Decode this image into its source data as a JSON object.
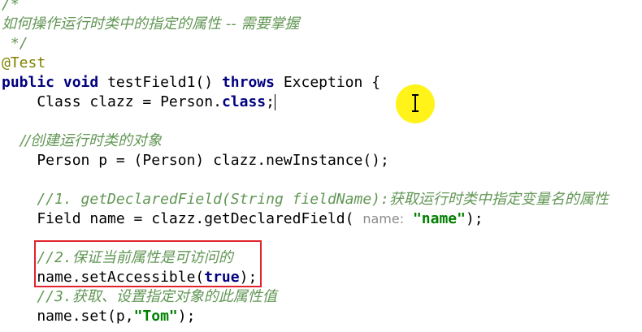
{
  "code": {
    "l1": "/*",
    "l2": "如何操作运行时类中的指定的属性 -- 需要掌握",
    "l3": " */",
    "l4_annotation": "@Test",
    "l5": {
      "kw1": "public",
      "kw2": "void",
      "name": " testField1() ",
      "kw3": "throws",
      "rest": " Exception {"
    },
    "l6": {
      "a": "    Class clazz = Person.",
      "kw": "class",
      "b": ";"
    },
    "l8": "    //创建运行时类的对象",
    "l9": "    Person p = (Person) clazz.newInstance();",
    "l11": {
      "a": "    //1. getDeclaredField(String fieldName):",
      "b": "获取运行时类中指定变量名的属性"
    },
    "l12": {
      "a": "    Field name = clazz.getDeclaredField( ",
      "hint": "name:",
      "str": "\"name\"",
      "b": ");"
    },
    "l14": {
      "a": "    //2.",
      "b": "保证当前属性是可访问的"
    },
    "l15": {
      "a": "    name.setAccessible(",
      "kw": "true",
      "b": ");"
    },
    "l16": {
      "a": "    //3.",
      "b": "获取、设置指定对象的此属性值"
    },
    "l17": {
      "a": "    name.set(p,",
      "str": "\"Tom\"",
      "b": ");"
    }
  },
  "colors": {
    "comment": "#629755",
    "keyword": "#000080",
    "annotation": "#808000",
    "string": "#008000",
    "highlight_box": "#e0232d",
    "cursor_highlight": "#fff200"
  },
  "icons": {
    "mouse_cursor": "text-cursor-icon"
  }
}
